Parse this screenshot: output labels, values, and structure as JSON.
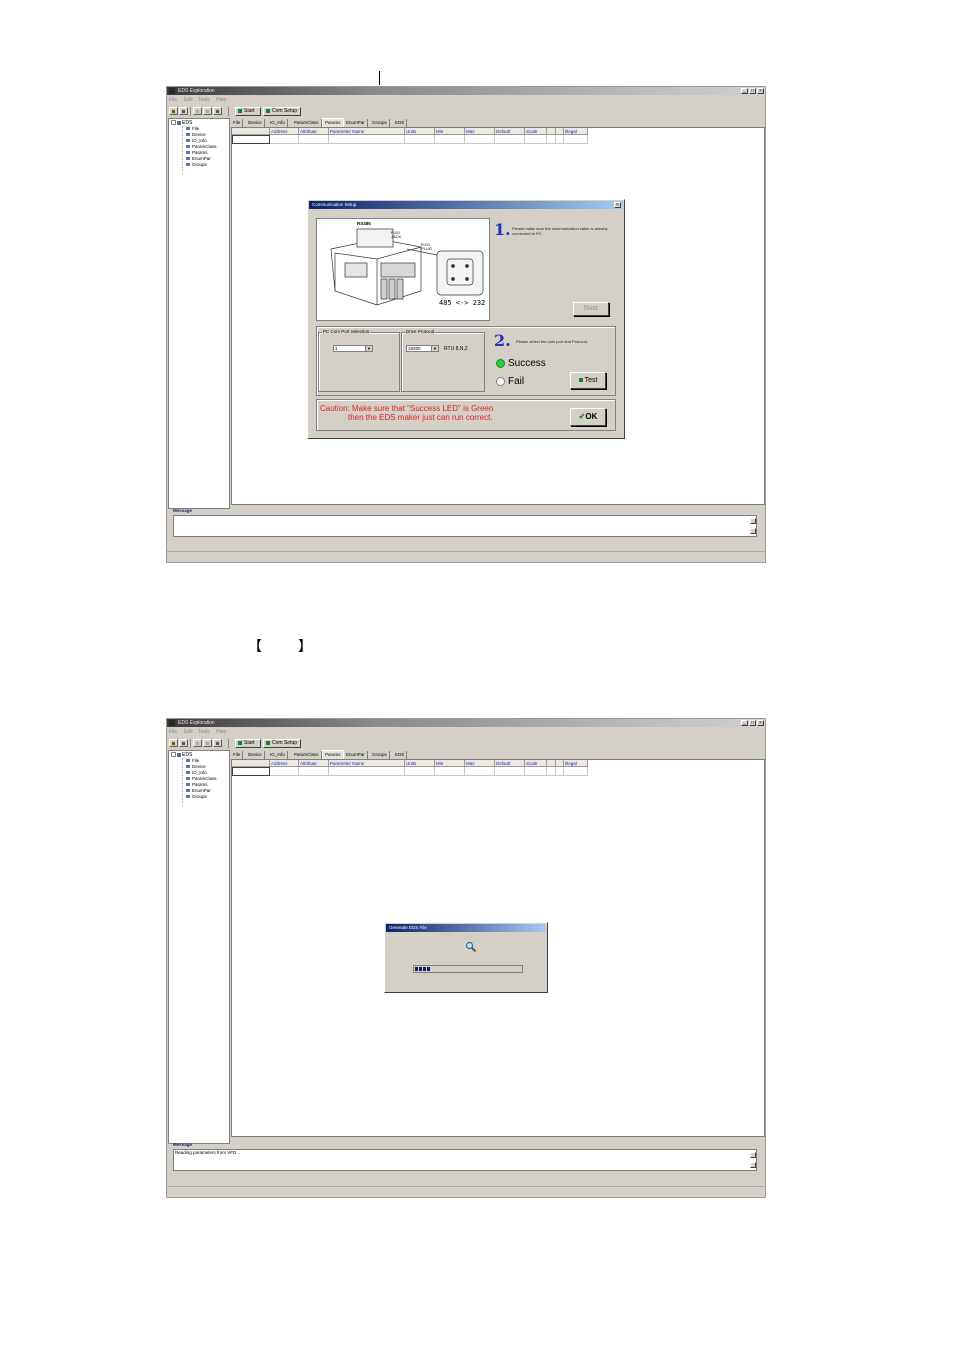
{
  "bracket_caption": {
    "left": "【",
    "right": "】"
  },
  "screenshot1": {
    "window_title": "EDS Exploration",
    "window_buttons": [
      "_",
      "□",
      "×"
    ],
    "menu": [
      "File",
      "Edit",
      "Tools",
      "Help"
    ],
    "toolbar": {
      "start_label": "Start",
      "com_setup_label": "Com Setup"
    },
    "tree": {
      "root": "EDS",
      "items": [
        "File",
        "Device",
        "IO_Info",
        "ParamClass",
        "Params",
        "EnumPar",
        "Groups"
      ]
    },
    "tabs": [
      "File",
      "Device",
      "IO_Info",
      "ParamClass",
      "Params",
      "EnumPar",
      "Groups",
      "EDS"
    ],
    "active_tab": "Params",
    "grid_headers": [
      "",
      "Address",
      "Attribute",
      "Parameter Name",
      "Units",
      "Min",
      "Max",
      "Default",
      "Scale",
      "",
      "",
      "Illegal"
    ],
    "message_label": "Message",
    "message_text": "",
    "dialog": {
      "title": "Communication Setup",
      "close": "×",
      "image_labels": {
        "rs485": "RS485",
        "jack": "RJ11\nJACK",
        "plug": "RJ11\nPLUG",
        "conv": "485 <-> 232"
      },
      "step1_num": "1.",
      "step1_text": "Please make sure the communication cable is already connected to PC.",
      "next_label": "Next",
      "com_port_group": "PC Com Port Selection",
      "com_port_value": "1",
      "protocol_group": "Drive Protocol",
      "baud_value": "19200",
      "protocol_text": "RTU 8,N,2",
      "step2_num": "2.",
      "step2_text": "Please select the com port and Protocol.",
      "success_label": "Success",
      "fail_label": "Fail",
      "test_label": "Test",
      "caution_line1": "Caution: Make sure that \"Success LED\" is Green",
      "caution_line2": "then the EDS maker just can run correct.",
      "ok_label": "OK",
      "colors": {
        "led_green": "#2ecc40",
        "caution": "#e02020",
        "step_blue": "#2030c0"
      }
    }
  },
  "screenshot2": {
    "window_title": "EDS Exploration",
    "window_buttons": [
      "_",
      "□",
      "×"
    ],
    "menu": [
      "File",
      "Edit",
      "Tools",
      "Help"
    ],
    "toolbar": {
      "start_label": "Start",
      "com_setup_label": "Com Setup"
    },
    "tree": {
      "root": "EDS",
      "items": [
        "File",
        "Device",
        "IO_Info",
        "ParamClass",
        "Params",
        "EnumPar",
        "Groups"
      ]
    },
    "tabs": [
      "File",
      "Device",
      "IO_Info",
      "ParamClass",
      "Params",
      "EnumPar",
      "Groups",
      "EDS"
    ],
    "active_tab": "Params",
    "grid_headers": [
      "",
      "Address",
      "Attribute",
      "Parameter Name",
      "Units",
      "Min",
      "Max",
      "Default",
      "Scale",
      "",
      "",
      "Illegal"
    ],
    "message_label": "Message",
    "message_text": "Reading parameters from VFD...",
    "progress_dialog": {
      "title": "Generate EDS File",
      "icon": "magnifier-icon",
      "progress_fraction": 0.14
    }
  }
}
